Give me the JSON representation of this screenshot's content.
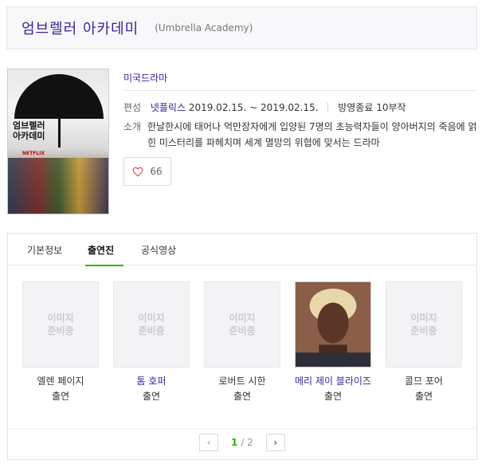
{
  "header": {
    "title": "엄브렐러 아카데미",
    "subtitle": "(Umbrella Academy)"
  },
  "poster": {
    "title_line1": "엄브렐러",
    "title_line2": "아카데미",
    "brand": "NETFLIX"
  },
  "info": {
    "genre": "미국드라마",
    "schedule_label": "편성",
    "broadcaster": "넷플릭스",
    "dates": "2019.02.15. ~ 2019.02.15.",
    "status": "방영종료 10부작",
    "summary_label": "소개",
    "summary": "한날한시에 태어나 억만장자에게 입양된 7명의 초능력자들이 양아버지의 죽음에 얽힌 미스터리를 파헤치며 세계 멸망의 위협에 맞서는 드라마"
  },
  "like": {
    "count": "66",
    "icon": "heart-icon"
  },
  "tabs": [
    {
      "label": "기본정보"
    },
    {
      "label": "출연진"
    },
    {
      "label": "공식영상"
    }
  ],
  "cast": [
    {
      "name": "엘렌 페이지",
      "role": "출연",
      "photo": "이미지\n준비중"
    },
    {
      "name": "톰 호퍼",
      "role": "출연",
      "photo": "이미지\n준비중"
    },
    {
      "name": "로버트 시한",
      "role": "출연",
      "photo": "이미지\n준비중"
    },
    {
      "name": "메리 제이 블라이즈",
      "role": "출연",
      "photo": ""
    },
    {
      "name": "콜므 포어",
      "role": "출연",
      "photo": "이미지\n준비중"
    }
  ],
  "pager": {
    "current": "1",
    "total": "2",
    "sep": "/",
    "prev": "‹",
    "next": "›"
  },
  "colors": {
    "accent": "#3a1f9e",
    "active_tab": "#2db400"
  }
}
